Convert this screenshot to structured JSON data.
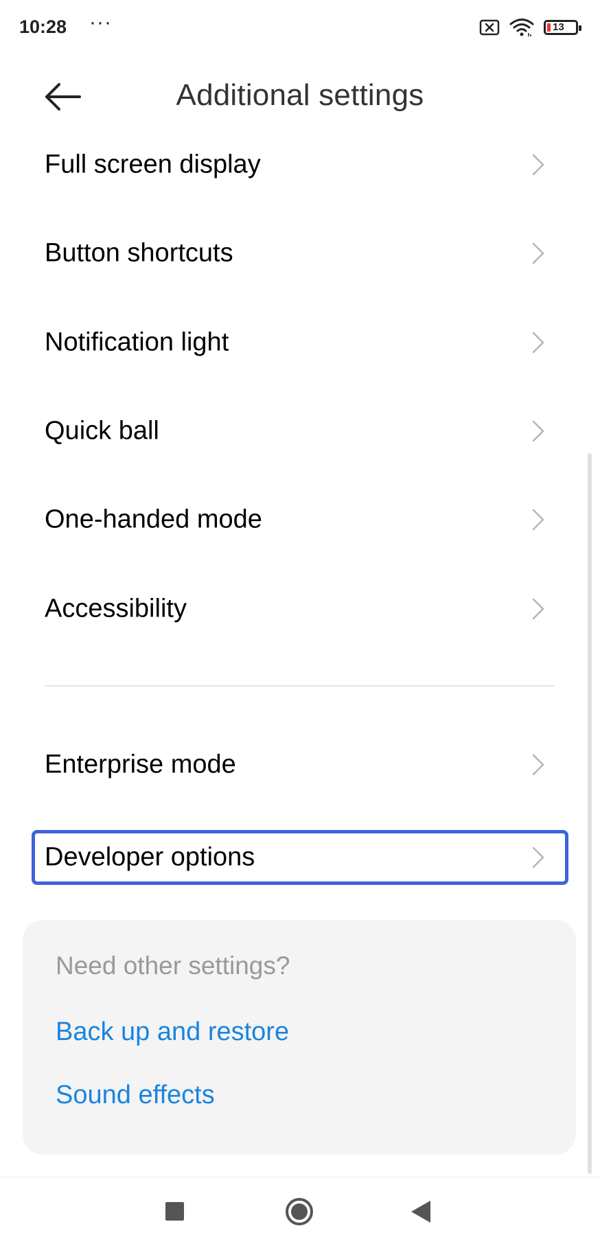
{
  "status_bar": {
    "time": "10:28",
    "dots": "···",
    "battery_level": "13",
    "icons": [
      "sim-disabled-icon",
      "wifi-icon",
      "battery-icon"
    ],
    "battery_color": "#e53935"
  },
  "header": {
    "title": "Additional settings",
    "back_icon": "arrow-left-icon"
  },
  "settings": {
    "items": [
      {
        "label": "Full screen display"
      },
      {
        "label": "Button shortcuts"
      },
      {
        "label": "Notification light"
      },
      {
        "label": "Quick ball"
      },
      {
        "label": "One-handed mode"
      },
      {
        "label": "Accessibility"
      },
      {
        "label": "Enterprise mode"
      },
      {
        "label": "Developer options",
        "focused": true
      }
    ]
  },
  "suggestions": {
    "title": "Need other settings?",
    "links": [
      {
        "label": "Back up and restore"
      },
      {
        "label": "Sound effects"
      }
    ]
  },
  "nav_bar": {
    "icons": [
      "recents-square-icon",
      "home-circle-icon",
      "back-triangle-icon"
    ]
  },
  "colors": {
    "focus_border": "#3d63dc",
    "link": "#1a84e0",
    "card_background": "#f4f4f4"
  }
}
